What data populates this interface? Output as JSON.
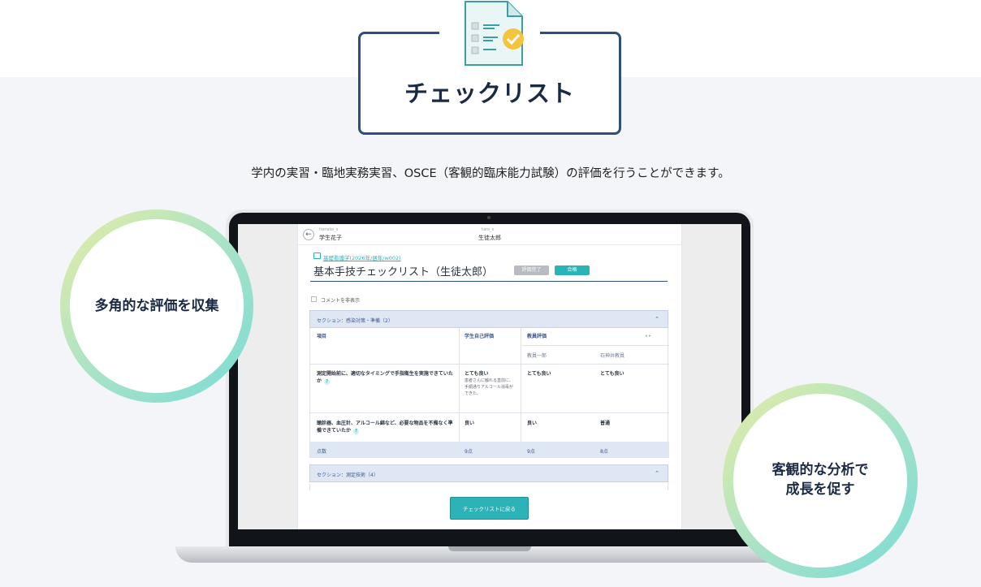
{
  "hero": {
    "title": "チェックリスト",
    "subtitle": "学内の実習・臨地実務実習、OSCE（客観的臨床能力試験）の評価を行うことができます。",
    "icon": "checklist-document-icon"
  },
  "features": {
    "left": "多角的な評価を収集",
    "right_line1": "客観的な分析で",
    "right_line2": "成長を促す"
  },
  "app": {
    "header": {
      "left_user_id": "hanako_s",
      "left_user_name": "学生花子",
      "center_user_id": "taro_s",
      "center_user_name": "生徒太郎"
    },
    "breadcrumb": "基礎看護学(2026年/週年/w002)",
    "title": "基本手技チェックリスト（生徒太郎）",
    "status_badge": "評価完了",
    "result_badge": "合格",
    "hide_comments_label": "コメントを非表示",
    "section1": {
      "label": "セクション：感染対策・準備（2）",
      "headers": {
        "item": "項目",
        "self": "学生自己評価",
        "teacher": "教員評価",
        "teacher1": "教員一郎",
        "teacher2": "石神井教員"
      },
      "rows": [
        {
          "item": "測定開始前に、適切なタイミングで手指衛生を実施できていたか",
          "self": "とても良い",
          "self_comment": "患者さんに触れる直前に、手順通りアルコール消毒ができた。",
          "t1": "とても良い",
          "t2": "とても良い"
        },
        {
          "item": "聴診器、血圧計、アルコール綿など、必要な物品を不備なく準備できていたか",
          "self": "良い",
          "self_comment": "",
          "t1": "良い",
          "t2": "普通"
        }
      ],
      "score": {
        "label": "点数",
        "self": "9点",
        "t1": "9点",
        "t2": "8点"
      }
    },
    "section2": {
      "label": "セクション：測定技術（4）"
    },
    "back_button": "チェックリストに戻る"
  }
}
